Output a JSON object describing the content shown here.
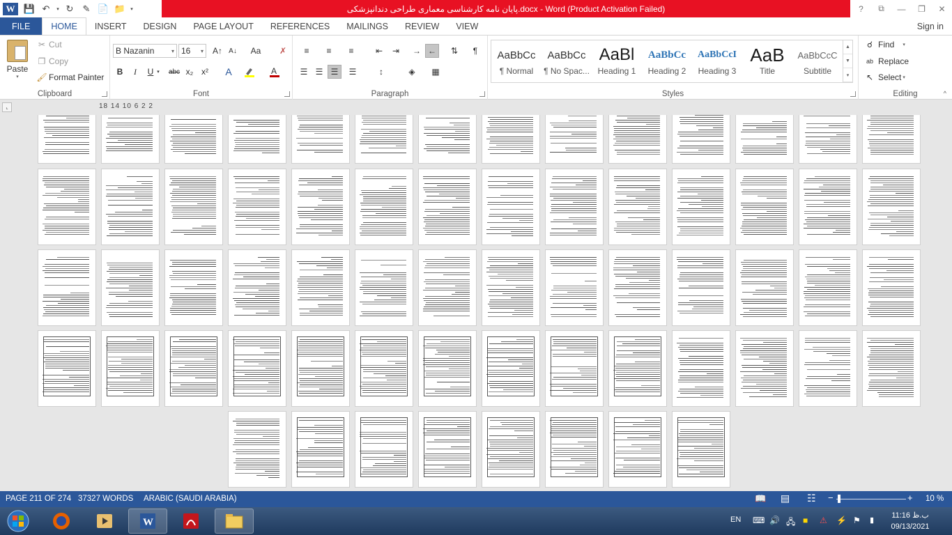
{
  "window": {
    "title": "پایان نامه کارشناسی معماری طراحی دندانپزشکی.docx - Word (Product Activation Failed)",
    "controls": [
      "?",
      "⧉",
      "—",
      "❐",
      "✕"
    ]
  },
  "quick_access": [
    "save-icon",
    "undo-icon",
    "redo-icon",
    "edit-icon",
    "new-icon",
    "open-icon",
    "customize-icon"
  ],
  "tabs": {
    "file": "FILE",
    "items": [
      "HOME",
      "INSERT",
      "DESIGN",
      "PAGE LAYOUT",
      "REFERENCES",
      "MAILINGS",
      "REVIEW",
      "VIEW"
    ],
    "active": "HOME",
    "sign_in": "Sign in"
  },
  "clipboard": {
    "paste": "Paste",
    "cut": "Cut",
    "copy": "Copy",
    "format_painter": "Format Painter",
    "label": "Clipboard"
  },
  "font": {
    "name": "B Nazanin",
    "size": "16",
    "label": "Font",
    "bold": "B",
    "italic": "I",
    "underline": "U",
    "strike": "abc",
    "subscript": "x₂",
    "superscript": "x²",
    "grow": "A↑",
    "shrink": "A↓",
    "case": "Aa",
    "font_color": "#c00000",
    "highlight_color": "#ffff00"
  },
  "paragraph": {
    "label": "Paragraph",
    "pilcrow": "¶"
  },
  "styles": {
    "label": "Styles",
    "items": [
      {
        "sample": "AaBbCc",
        "name": "¶ Normal"
      },
      {
        "sample": "AaBbCc",
        "name": "¶ No Spac..."
      },
      {
        "sample": "AaBl",
        "name": "Heading 1"
      },
      {
        "sample": "AaBbCc",
        "name": "Heading 2"
      },
      {
        "sample": "AaBbCcI",
        "name": "Heading 3"
      },
      {
        "sample": "AaB",
        "name": "Title"
      },
      {
        "sample": "AaBbCcC",
        "name": "Subtitle"
      }
    ]
  },
  "editing": {
    "label": "Editing",
    "find": "Find",
    "replace": "Replace",
    "select": "Select"
  },
  "ruler": {
    "numbers": "18 14 10 6 2 2"
  },
  "status": {
    "page": "PAGE 211 OF 274",
    "words": "37327 WORDS",
    "language": "ARABIC (SAUDI ARABIA)",
    "zoom": "10 %",
    "zoom_level": 0.02
  },
  "taskbar": {
    "apps": [
      "start-orb-icon",
      "firefox-icon",
      "media-player-icon",
      "word-icon",
      "acrobat-icon",
      "explorer-icon"
    ],
    "lang": "EN",
    "time": "11:16 ب.ظ",
    "date": "09/13/2021"
  },
  "colors": {
    "brand_blue": "#2b579a",
    "title_red": "#e81123"
  }
}
